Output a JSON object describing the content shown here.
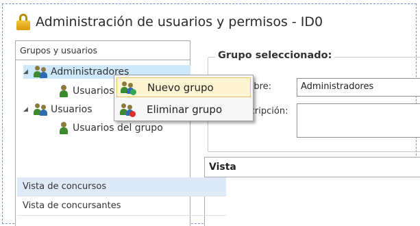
{
  "window": {
    "title": "Administración de usuarios y permisos - ID0",
    "icon": "lock-icon"
  },
  "tree": {
    "header": "Grupos y usuarios",
    "nodes": [
      {
        "label": "Administradores",
        "children": [
          "Usuarios del grupo"
        ]
      },
      {
        "label": "Usuarios",
        "children": [
          "Usuarios del grupo"
        ]
      }
    ]
  },
  "context_menu": {
    "items": [
      {
        "label": "Nuevo grupo",
        "icon": "add-group-icon"
      },
      {
        "label": "Eliminar grupo",
        "icon": "delete-group-icon"
      }
    ]
  },
  "group_form": {
    "legend": "Grupo seleccionado:",
    "name_label": "Nombre:",
    "name_value": "Administradores",
    "description_label": "Descripción:",
    "description_value": ""
  },
  "vista": {
    "header": "Vista",
    "rows": [
      "Vista de concursos",
      "Vista de concursantes"
    ]
  },
  "colors": {
    "accent_selection": "#cde8fb",
    "menu_hover": "#fdf4d2",
    "frame_border": "#6f93cf"
  }
}
